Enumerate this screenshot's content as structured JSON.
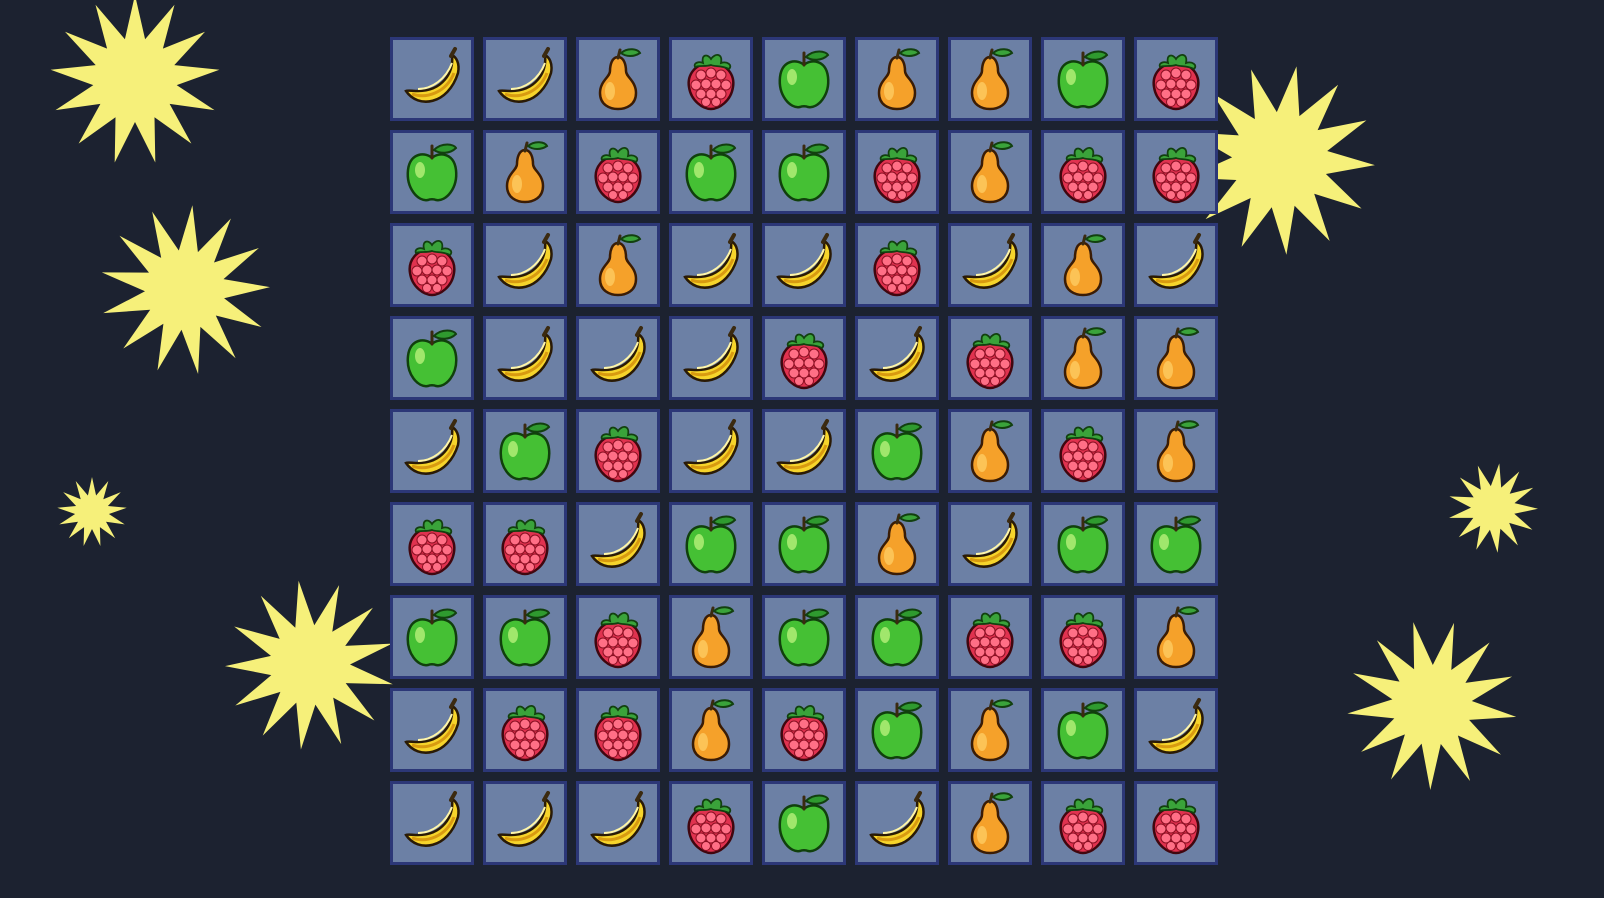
{
  "colors": {
    "background": "#1c2230",
    "tile_fill": "#6c80a5",
    "tile_border": "#2c3777",
    "burst": "#f6f07a"
  },
  "board": {
    "rows": 9,
    "cols": 9,
    "grid": [
      [
        "banana",
        "banana",
        "pear",
        "raspberry",
        "apple",
        "pear",
        "pear",
        "apple",
        "raspberry"
      ],
      [
        "apple",
        "pear",
        "raspberry",
        "apple",
        "apple",
        "raspberry",
        "pear",
        "raspberry",
        "raspberry"
      ],
      [
        "raspberry",
        "banana",
        "pear",
        "banana",
        "banana",
        "raspberry",
        "banana",
        "pear",
        "banana"
      ],
      [
        "apple",
        "banana",
        "banana",
        "banana",
        "raspberry",
        "banana",
        "raspberry",
        "pear",
        "pear"
      ],
      [
        "banana",
        "apple",
        "raspberry",
        "banana",
        "banana",
        "apple",
        "pear",
        "raspberry",
        "pear"
      ],
      [
        "raspberry",
        "raspberry",
        "banana",
        "apple",
        "apple",
        "pear",
        "banana",
        "apple",
        "apple"
      ],
      [
        "apple",
        "apple",
        "raspberry",
        "pear",
        "apple",
        "apple",
        "raspberry",
        "raspberry",
        "pear"
      ],
      [
        "banana",
        "raspberry",
        "raspberry",
        "pear",
        "raspberry",
        "apple",
        "pear",
        "apple",
        "banana"
      ],
      [
        "banana",
        "banana",
        "banana",
        "raspberry",
        "apple",
        "banana",
        "pear",
        "raspberry",
        "raspberry"
      ]
    ]
  },
  "icons": {
    "banana": "banana-icon",
    "pear": "pear-icon",
    "apple": "green-apple-icon",
    "raspberry": "raspberry-icon"
  },
  "decorations": [
    "starburst-icon"
  ]
}
